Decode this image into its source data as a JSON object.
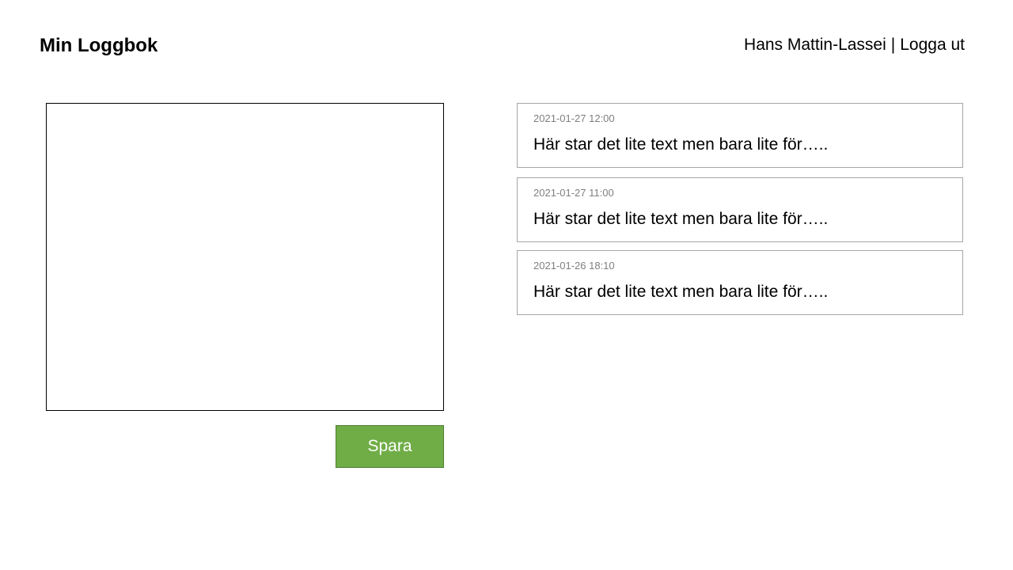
{
  "header": {
    "title": "Min Loggbok",
    "user_name": "Hans Mattin-Lassei",
    "separator": "|",
    "logout_label": "Logga ut"
  },
  "editor": {
    "value": "",
    "placeholder": ""
  },
  "save_button": {
    "label": "Spara",
    "color": "#70ad47"
  },
  "entries": [
    {
      "date": "2021-01-27 12:00",
      "text": "Här star det lite text men bara lite för….."
    },
    {
      "date": "2021-01-27 11:00",
      "text": "Här star det lite text men bara lite för….."
    },
    {
      "date": "2021-01-26 18:10",
      "text": "Här star det lite text men bara lite för….."
    }
  ]
}
